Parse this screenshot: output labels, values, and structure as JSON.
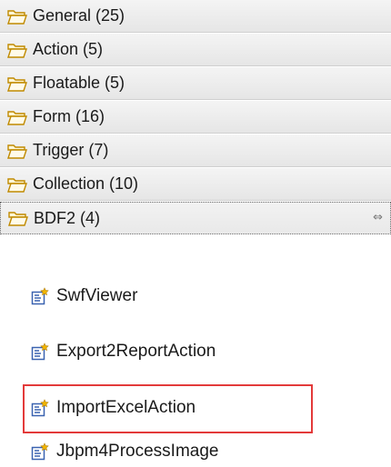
{
  "drawers": [
    {
      "label": "General (25)"
    },
    {
      "label": "Action (5)"
    },
    {
      "label": "Floatable (5)"
    },
    {
      "label": "Form (16)"
    },
    {
      "label": "Trigger (7)"
    },
    {
      "label": "Collection (10)"
    },
    {
      "label": "BDF2 (4)",
      "expanded": true
    }
  ],
  "pin_icon": "⇔",
  "tools": [
    {
      "label": "SwfViewer"
    },
    {
      "label": "Export2ReportAction"
    },
    {
      "label": "ImportExcelAction",
      "highlighted": true
    },
    {
      "label": "Jbpm4ProcessImage"
    }
  ],
  "colors": {
    "highlight_border": "#e33a3a",
    "folder_stroke": "#c08a00",
    "folder_fill": "#fff7d6"
  }
}
